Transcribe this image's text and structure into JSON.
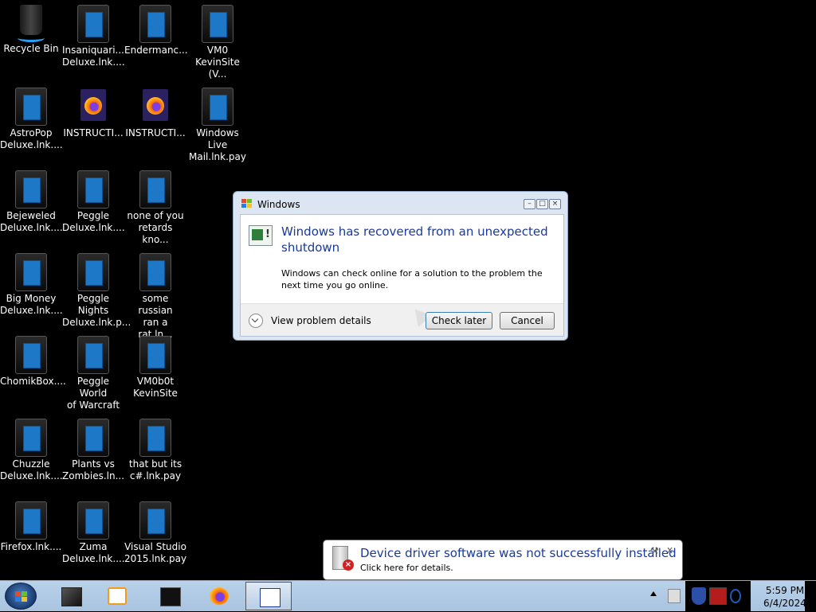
{
  "desktop": {
    "icons": [
      {
        "label": "Recycle Bin"
      },
      {
        "label": "Insaniquari...\nDeluxe.lnk...."
      },
      {
        "label": "Endermanc..."
      },
      {
        "label": "VM0\nKevinSite (V..."
      },
      {
        "label": "AstroPop\nDeluxe.lnk...."
      },
      {
        "label": "INSTRUCTI..."
      },
      {
        "label": "INSTRUCTI..."
      },
      {
        "label": "Windows Live\nMail.lnk.pay"
      },
      {
        "label": "Bejeweled\nDeluxe.lnk...."
      },
      {
        "label": "Peggle\nDeluxe.lnk...."
      },
      {
        "label": "none of you\nretards kno..."
      },
      {
        "label": "Big Money\nDeluxe.lnk...."
      },
      {
        "label": "Peggle Nights\nDeluxe.lnk.p..."
      },
      {
        "label": "some russian\nran a rat.ln..."
      },
      {
        "label": "ChomikBox...."
      },
      {
        "label": "Peggle World\nof Warcraft ..."
      },
      {
        "label": "VM0b0t\nKevinSite"
      },
      {
        "label": "Chuzzle\nDeluxe.lnk...."
      },
      {
        "label": "Plants vs\nZombies.ln..."
      },
      {
        "label": "that but its\nc#.lnk.pay"
      },
      {
        "label": "Firefox.lnk...."
      },
      {
        "label": "Zuma\nDeluxe.lnk...."
      },
      {
        "label": "Visual Studio\n2015.lnk.pay"
      }
    ]
  },
  "dialog": {
    "title": "Windows",
    "headline": "Windows has recovered from an unexpected shutdown",
    "body": "Windows can check online for a solution to the problem the next time you go online.",
    "details_label": "View problem details",
    "check_later_label": "Check later",
    "cancel_label": "Cancel"
  },
  "balloon": {
    "title": "Device driver software was not successfully installed",
    "subtitle": "Click here for details.",
    "close_label": "x"
  },
  "taskbar": {
    "clock_time": "5:59 PM",
    "clock_date": "6/4/2024"
  },
  "colors": {
    "accent_blue": "#1a3a9a",
    "taskbar": "#b9d1ea"
  }
}
